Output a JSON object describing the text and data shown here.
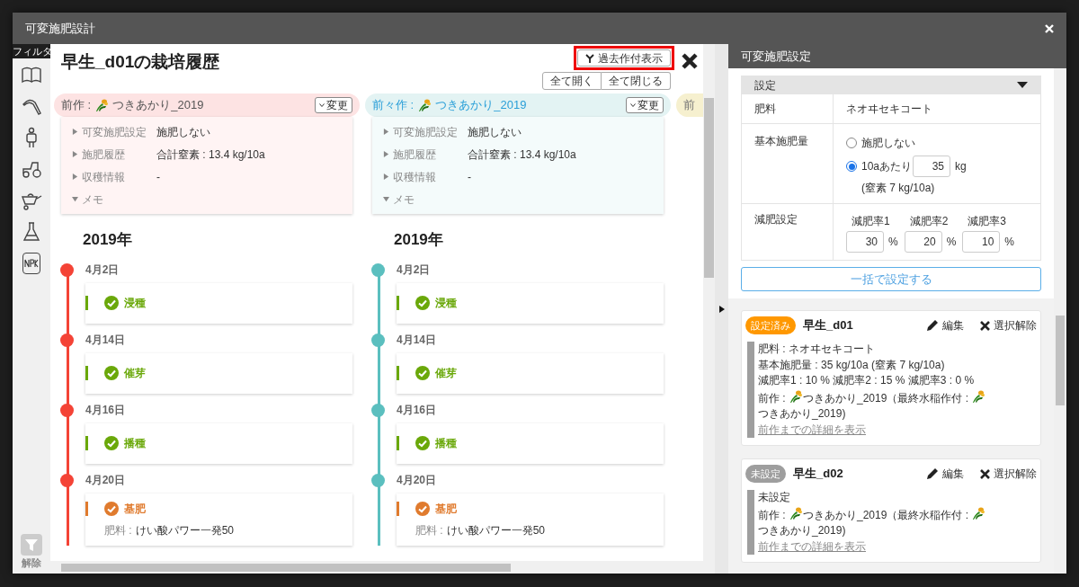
{
  "window": {
    "title": "可変施肥設計"
  },
  "filter_sidebar": {
    "label": "フィルタ",
    "clear_label": "解除"
  },
  "history": {
    "title": "早生_d01の栽培履歴",
    "past_button": "過去作付表示",
    "expand_all": "全て開く",
    "collapse_all": "全て閉じる",
    "crops": [
      {
        "kind": "previous",
        "label": "前作 :",
        "name": "つきあかり_2019",
        "change": "変更",
        "color": "#f44336",
        "year": "2019年",
        "details": [
          {
            "label": "可変施肥設定",
            "value": "施肥しない",
            "expanded": false
          },
          {
            "label": "施肥履歴",
            "value": "合計窒素 : 13.4 kg/10a",
            "expanded": false
          },
          {
            "label": "収穫情報",
            "value": "-",
            "expanded": false
          },
          {
            "label": "メモ",
            "expanded": true
          }
        ],
        "events": [
          {
            "date": "4月2日",
            "name": "浸種",
            "kind": "work"
          },
          {
            "date": "4月14日",
            "name": "催芽",
            "kind": "work"
          },
          {
            "date": "4月16日",
            "name": "播種",
            "kind": "work"
          },
          {
            "date": "4月20日",
            "name": "基肥",
            "kind": "fertilizer",
            "detail_label": "肥料 :",
            "detail_value": "けい酸パワー一発50"
          }
        ]
      },
      {
        "kind": "before_previous",
        "label": "前々作 :",
        "name": "つきあかり_2019",
        "change": "変更",
        "color": "#5bbfbf",
        "year": "2019年",
        "details": [
          {
            "label": "可変施肥設定",
            "value": "施肥しない",
            "expanded": false
          },
          {
            "label": "施肥履歴",
            "value": "合計窒素 : 13.4 kg/10a",
            "expanded": false
          },
          {
            "label": "収穫情報",
            "value": "-",
            "expanded": false
          },
          {
            "label": "メモ",
            "expanded": true
          }
        ],
        "events": [
          {
            "date": "4月2日",
            "name": "浸種",
            "kind": "work"
          },
          {
            "date": "4月14日",
            "name": "催芽",
            "kind": "work"
          },
          {
            "date": "4月16日",
            "name": "播種",
            "kind": "work"
          },
          {
            "date": "4月20日",
            "name": "基肥",
            "kind": "fertilizer",
            "detail_label": "肥料 :",
            "detail_value": "けい酸パワー一発50"
          }
        ]
      },
      {
        "kind": "older",
        "label": "前"
      }
    ]
  },
  "settings": {
    "title": "可変施肥設定",
    "section": "設定",
    "expanded": true,
    "fertilizer_label": "肥料",
    "fertilizer_value": "ネオヰセキコート",
    "base_label": "基本施肥量",
    "base_options": [
      {
        "label": "施肥しない",
        "selected": false
      },
      {
        "label": "10aあたり",
        "selected": true,
        "value": "35",
        "unit": "kg"
      }
    ],
    "base_note": "(窒素 7 kg/10a)",
    "reduction_label": "減肥設定",
    "reductions": [
      {
        "label": "減肥率1",
        "value": "30",
        "unit": "%"
      },
      {
        "label": "減肥率2",
        "value": "20",
        "unit": "%"
      },
      {
        "label": "減肥率3",
        "value": "10",
        "unit": "%"
      }
    ],
    "apply_button": "一括で設定する"
  },
  "fields": [
    {
      "status": "設定済み",
      "configured": true,
      "name": "早生_d01",
      "edit": "編集",
      "deselect": "選択解除",
      "lines": [
        "肥料 : ネオヰセキコート",
        "基本施肥量 : 35 kg/10a  (窒素 7 kg/10a)",
        "減肥率1 : 10 %  減肥率2 : 15 %  減肥率3 : 0 %"
      ],
      "previous": {
        "prefix": "前作 : ",
        "crop": "つきあかり_2019",
        "middle": "（最終水稲作付 : ",
        "last_crop": "つきあかり_2019",
        "suffix": ")"
      },
      "link": "前作までの詳細を表示"
    },
    {
      "status": "未設定",
      "configured": false,
      "name": "早生_d02",
      "edit": "編集",
      "deselect": "選択解除",
      "lines": [
        "未設定"
      ],
      "previous": {
        "prefix": "前作 : ",
        "crop": "つきあかり_2019",
        "middle": "（最終水稲作付 : ",
        "last_crop": "つきあかり_2019",
        "suffix": ")"
      },
      "link": "前作までの詳細を表示"
    }
  ]
}
